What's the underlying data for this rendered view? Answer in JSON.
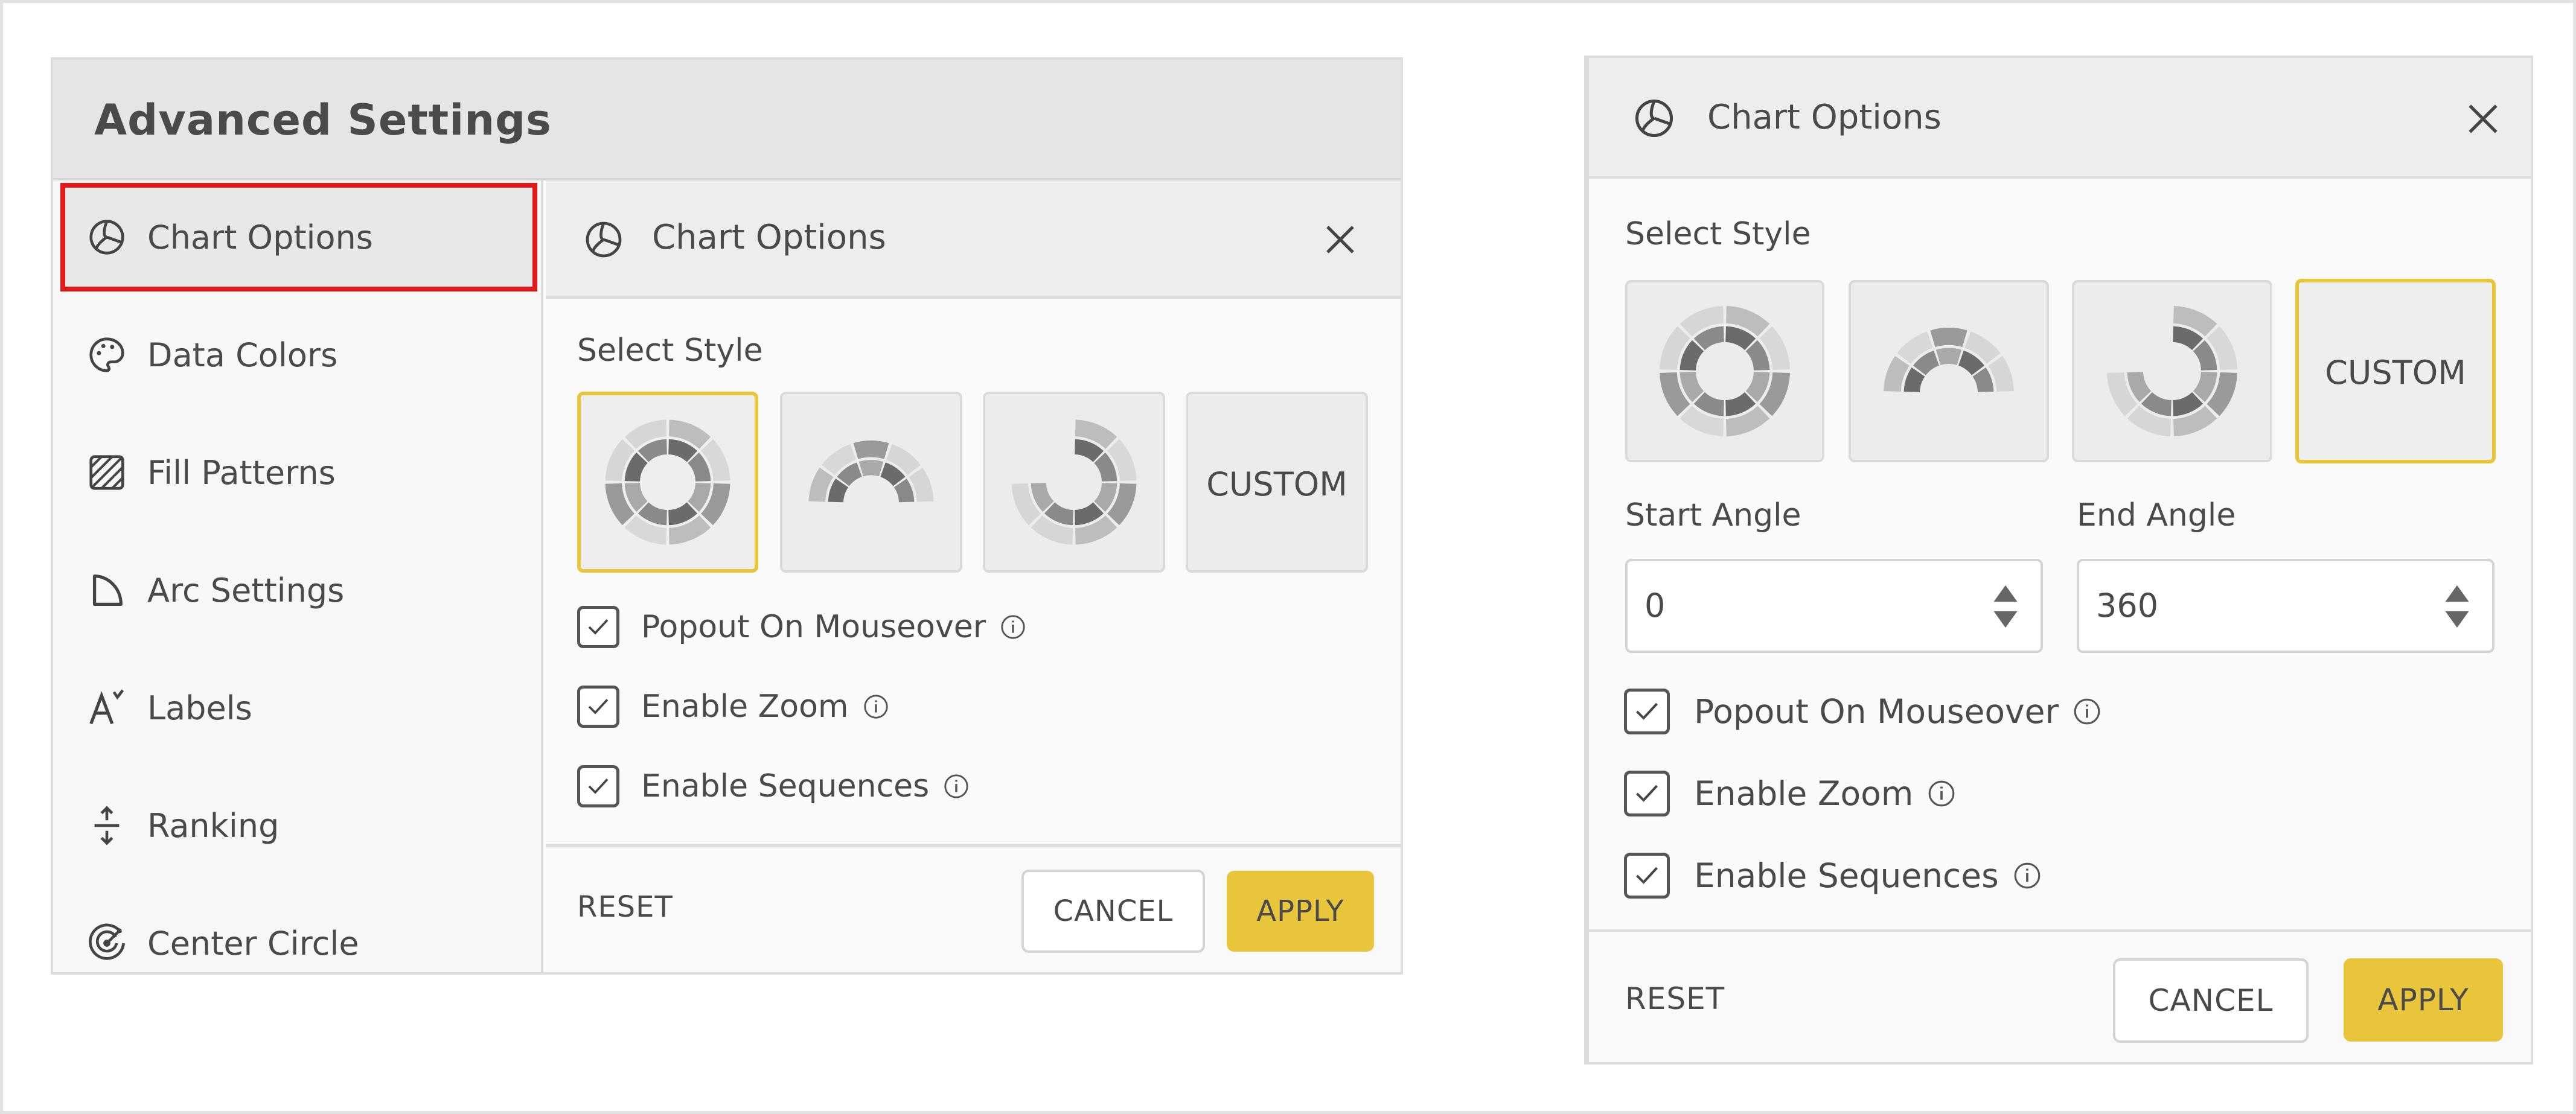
{
  "advanced_settings": {
    "title": "Advanced Settings",
    "sidebar": [
      {
        "label": "Chart Options",
        "icon": "chart-options-icon",
        "active": true
      },
      {
        "label": "Data Colors",
        "icon": "palette-icon"
      },
      {
        "label": "Fill Patterns",
        "icon": "hatch-pattern-icon"
      },
      {
        "label": "Arc Settings",
        "icon": "arc-icon"
      },
      {
        "label": "Labels",
        "icon": "label-text-icon"
      },
      {
        "label": "Ranking",
        "icon": "ranking-icon"
      },
      {
        "label": "Center Circle",
        "icon": "center-circle-icon"
      }
    ],
    "chart_options": {
      "title": "Chart Options",
      "select_style_label": "Select Style",
      "styles": [
        "full-sunburst",
        "semi-sunburst",
        "three-quarter-sunburst",
        "CUSTOM"
      ],
      "selected_style": "full-sunburst",
      "checkboxes": [
        {
          "label": "Popout On Mouseover",
          "checked": true
        },
        {
          "label": "Enable Zoom",
          "checked": true
        },
        {
          "label": "Enable Sequences",
          "checked": true
        }
      ],
      "reset_label": "RESET",
      "cancel_label": "CANCEL",
      "apply_label": "APPLY"
    }
  },
  "chart_options_custom": {
    "title": "Chart Options",
    "select_style_label": "Select Style",
    "custom_label": "CUSTOM",
    "selected_style": "CUSTOM",
    "start_angle_label": "Start Angle",
    "start_angle_value": "0",
    "end_angle_label": "End Angle",
    "end_angle_value": "360",
    "checkboxes": [
      {
        "label": "Popout On Mouseover",
        "checked": true
      },
      {
        "label": "Enable Zoom",
        "checked": true
      },
      {
        "label": "Enable Sequences",
        "checked": true
      }
    ],
    "reset_label": "RESET",
    "cancel_label": "CANCEL",
    "apply_label": "APPLY"
  },
  "colors": {
    "accent": "#e8c53a",
    "highlight_border": "#e31a1a",
    "text": "#4a4a4a"
  }
}
